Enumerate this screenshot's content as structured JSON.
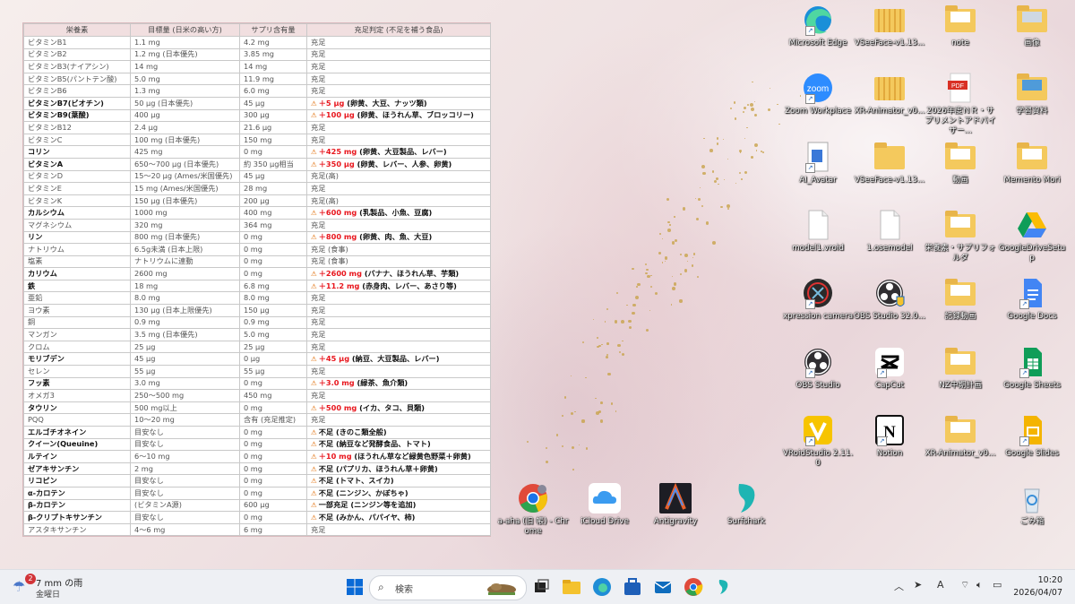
{
  "table": {
    "headers": [
      "栄養素",
      "目標量 (日米の高い方)",
      "サプリ含有量",
      "充足判定 (不足を補う食品)"
    ],
    "rows": [
      {
        "name": "ビタミンB1",
        "target": "1.1 mg",
        "supp": "4.2 mg",
        "status": "充足",
        "shortfall": false
      },
      {
        "name": "ビタミンB2",
        "target": "1.2 mg (日本優先)",
        "supp": "3.85 mg",
        "status": "充足",
        "shortfall": false
      },
      {
        "name": "ビタミンB3(ナイアシン)",
        "target": "14 mg",
        "supp": "14 mg",
        "status": "充足",
        "shortfall": false
      },
      {
        "name": "ビタミンB5(パントテン酸)",
        "target": "5.0 mg",
        "supp": "11.9 mg",
        "status": "充足",
        "shortfall": false
      },
      {
        "name": "ビタミンB6",
        "target": "1.3 mg",
        "supp": "6.0 mg",
        "status": "充足",
        "shortfall": false
      },
      {
        "name": "ビタミンB7(ビオチン)",
        "target": "50 μg (日本優先)",
        "supp": "45 μg",
        "amount": "＋5 μg",
        "status": "(卵黄、大豆、ナッツ類)",
        "shortfall": true
      },
      {
        "name": "ビタミンB9(葉酸)",
        "target": "400 μg",
        "supp": "300 μg",
        "amount": "＋100 μg",
        "status": "(卵黄、ほうれん草、ブロッコリー)",
        "shortfall": true
      },
      {
        "name": "ビタミンB12",
        "target": "2.4 μg",
        "supp": "21.6 μg",
        "status": "充足",
        "shortfall": false
      },
      {
        "name": "ビタミンC",
        "target": "100 mg (日本優先)",
        "supp": "150 mg",
        "status": "充足",
        "shortfall": false
      },
      {
        "name": "コリン",
        "target": "425 mg",
        "supp": "0 mg",
        "amount": "＋425 mg",
        "status": "(卵黄、大豆製品、レバー)",
        "shortfall": true
      },
      {
        "name": "ビタミンA",
        "target": "650〜700 μg (日本優先)",
        "supp": "約 350 μg相当",
        "amount": "＋350 μg",
        "status": "(卵黄、レバー、人参、卵黄)",
        "shortfall": true
      },
      {
        "name": "ビタミンD",
        "target": "15〜20 μg (Ames/米国優先)",
        "supp": "45 μg",
        "status": "充足(高)",
        "shortfall": false
      },
      {
        "name": "ビタミンE",
        "target": "15 mg (Ames/米国優先)",
        "supp": "28 mg",
        "status": "充足",
        "shortfall": false
      },
      {
        "name": "ビタミンK",
        "target": "150 μg (日本優先)",
        "supp": "200 μg",
        "status": "充足(高)",
        "shortfall": false
      },
      {
        "name": "カルシウム",
        "target": "1000 mg",
        "supp": "400 mg",
        "amount": "＋600 mg",
        "status": "(乳製品、小魚、豆腐)",
        "shortfall": true
      },
      {
        "name": "マグネシウム",
        "target": "320 mg",
        "supp": "364 mg",
        "status": "充足",
        "shortfall": false
      },
      {
        "name": "リン",
        "target": "800 mg (日本優先)",
        "supp": "0 mg",
        "amount": "＋800 mg",
        "status": "(卵黄、肉、魚、大豆)",
        "shortfall": true
      },
      {
        "name": "ナトリウム",
        "target": "6.5g未満 (日本上限)",
        "supp": "0 mg",
        "status": "充足 (食事)",
        "shortfall": false
      },
      {
        "name": "塩素",
        "target": "ナトリウムに連動",
        "supp": "0 mg",
        "status": "充足 (食事)",
        "shortfall": false
      },
      {
        "name": "カリウム",
        "target": "2600 mg",
        "supp": "0 mg",
        "amount": "＋2600 mg",
        "status": "(バナナ、ほうれん草、芋類)",
        "shortfall": true
      },
      {
        "name": "鉄",
        "target": "18 mg",
        "supp": "6.8 mg",
        "amount": "＋11.2 mg",
        "status": "(赤身肉、レバー、あさり等)",
        "shortfall": true
      },
      {
        "name": "亜鉛",
        "target": "8.0 mg",
        "supp": "8.0 mg",
        "status": "充足",
        "shortfall": false
      },
      {
        "name": "ヨウ素",
        "target": "130 μg (日本上限優先)",
        "supp": "150 μg",
        "status": "充足",
        "shortfall": false
      },
      {
        "name": "銅",
        "target": "0.9 mg",
        "supp": "0.9 mg",
        "status": "充足",
        "shortfall": false
      },
      {
        "name": "マンガン",
        "target": "3.5 mg (日本優先)",
        "supp": "5.0 mg",
        "status": "充足",
        "shortfall": false
      },
      {
        "name": "クロム",
        "target": "25 μg",
        "supp": "25 μg",
        "status": "充足",
        "shortfall": false
      },
      {
        "name": "モリブデン",
        "target": "45 μg",
        "supp": "0 μg",
        "amount": "＋45 μg",
        "status": "(納豆、大豆製品、レバー)",
        "shortfall": true
      },
      {
        "name": "セレン",
        "target": "55 μg",
        "supp": "55 μg",
        "status": "充足",
        "shortfall": false
      },
      {
        "name": "フッ素",
        "target": "3.0 mg",
        "supp": "0 mg",
        "amount": "＋3.0 mg",
        "status": "(緑茶、魚介類)",
        "shortfall": true
      },
      {
        "name": "オメガ3",
        "target": "250〜500 mg",
        "supp": "450 mg",
        "status": "充足",
        "shortfall": false
      },
      {
        "name": "タウリン",
        "target": "500 mg以上",
        "supp": "0 mg",
        "amount": "＋500 mg",
        "status": "(イカ、タコ、貝類)",
        "shortfall": true
      },
      {
        "name": "PQQ",
        "target": "10〜20 mg",
        "supp": "含有 (充足推定)",
        "status": "充足",
        "shortfall": false
      },
      {
        "name": "エルゴチオネイン",
        "target": "目安なし",
        "supp": "0 mg",
        "status": "不足 (きのこ類全般)",
        "shortfall": true
      },
      {
        "name": "クイーン(Queuine)",
        "target": "目安なし",
        "supp": "0 mg",
        "status": "不足 (納豆など発酵食品、トマト)",
        "shortfall": true
      },
      {
        "name": "ルテイン",
        "target": "6〜10 mg",
        "supp": "0 mg",
        "amount": "＋10 mg",
        "status": "(ほうれん草など緑黄色野菜＋卵黄)",
        "shortfall": true
      },
      {
        "name": "ゼアキサンチン",
        "target": "2 mg",
        "supp": "0 mg",
        "status": "不足 (パプリカ、ほうれん草＋卵黄)",
        "shortfall": true
      },
      {
        "name": "リコピン",
        "target": "目安なし",
        "supp": "0 mg",
        "status": "不足 (トマト、スイカ)",
        "shortfall": true
      },
      {
        "name": "α-カロテン",
        "target": "目安なし",
        "supp": "0 mg",
        "status": "不足 (ニンジン、かぼちゃ)",
        "shortfall": true
      },
      {
        "name": "β-カロテン",
        "target": "(ビタミンA源)",
        "supp": "600 μg",
        "status": "一部充足 (ニンジン等を追加)",
        "shortfall": "partial"
      },
      {
        "name": "β-クリプトキサンチン",
        "target": "目安なし",
        "supp": "0 mg",
        "status": "不足 (みかん、パパイヤ、柿)",
        "shortfall": true
      },
      {
        "name": "アスタキサンチン",
        "target": "4〜6 mg",
        "supp": "6 mg",
        "status": "充足",
        "shortfall": false
      }
    ]
  },
  "desktop_icons": [
    {
      "label": "Microsoft Edge",
      "kind": "edge",
      "col": 0,
      "row": 0,
      "shortcut": true
    },
    {
      "label": "VSeeFace-v1.13...",
      "kind": "zip",
      "col": 1,
      "row": 0,
      "shortcut": false
    },
    {
      "label": "note",
      "kind": "folder",
      "col": 2,
      "row": 0,
      "shortcut": false
    },
    {
      "label": "画像",
      "kind": "folder-img",
      "col": 3,
      "row": 0,
      "shortcut": false
    },
    {
      "label": "Zoom Workplace",
      "kind": "zoom",
      "col": 0,
      "row": 1,
      "shortcut": true
    },
    {
      "label": "XR-Animator_v0...",
      "kind": "zip",
      "col": 1,
      "row": 1,
      "shortcut": false
    },
    {
      "label": "2026年度ＮＲ・サプリメントアドバイザー...",
      "kind": "pdf",
      "col": 2,
      "row": 1,
      "shortcut": false
    },
    {
      "label": "学習資料",
      "kind": "folder-blue",
      "col": 3,
      "row": 1,
      "shortcut": false
    },
    {
      "label": "AI_Avatar",
      "kind": "file-blue",
      "col": 0,
      "row": 2,
      "shortcut": true
    },
    {
      "label": "VSeeFace-v1.13...",
      "kind": "folder-plain",
      "col": 1,
      "row": 2,
      "shortcut": false
    },
    {
      "label": "動画",
      "kind": "folder",
      "col": 2,
      "row": 2,
      "shortcut": false
    },
    {
      "label": "Memento Mori",
      "kind": "folder",
      "col": 3,
      "row": 2,
      "shortcut": false
    },
    {
      "label": "model1.vroid",
      "kind": "doc",
      "col": 0,
      "row": 3,
      "shortcut": false
    },
    {
      "label": "1.osemodel",
      "kind": "doc",
      "col": 1,
      "row": 3,
      "shortcut": false
    },
    {
      "label": "栄養素・サプリフォルダ",
      "kind": "folder",
      "col": 2,
      "row": 3,
      "shortcut": false
    },
    {
      "label": "GoogleDriveSetup",
      "kind": "gdrive",
      "col": 3,
      "row": 3,
      "shortcut": false
    },
    {
      "label": "xpression camera",
      "kind": "xpression",
      "col": 0,
      "row": 4,
      "shortcut": true
    },
    {
      "label": "OBS Studio 32.0...",
      "kind": "obs-shield",
      "col": 1,
      "row": 4,
      "shortcut": false
    },
    {
      "label": "記録動画",
      "kind": "folder",
      "col": 2,
      "row": 4,
      "shortcut": false
    },
    {
      "label": "Google Docs",
      "kind": "gdocs",
      "col": 3,
      "row": 4,
      "shortcut": true
    },
    {
      "label": "OBS Studio",
      "kind": "obs",
      "col": 0,
      "row": 5,
      "shortcut": true
    },
    {
      "label": "CapCut",
      "kind": "capcut",
      "col": 1,
      "row": 5,
      "shortcut": true
    },
    {
      "label": "NZ中期計画",
      "kind": "folder",
      "col": 2,
      "row": 5,
      "shortcut": false
    },
    {
      "label": "Google Sheets",
      "kind": "gsheets",
      "col": 3,
      "row": 5,
      "shortcut": true
    },
    {
      "label": "VRoidStudio 2.11.0",
      "kind": "vroid",
      "col": 0,
      "row": 6,
      "shortcut": true
    },
    {
      "label": "Notion",
      "kind": "notion",
      "col": 1,
      "row": 6,
      "shortcut": true
    },
    {
      "label": "XR-Animator_v0...",
      "kind": "folder",
      "col": 2,
      "row": 6,
      "shortcut": false
    },
    {
      "label": "Google Slides",
      "kind": "gslides",
      "col": 3,
      "row": 6,
      "shortcut": true
    },
    {
      "label": "ごみ箱",
      "kind": "recycle",
      "col": 3,
      "row": 7,
      "shortcut": false
    }
  ],
  "lower_icons": [
    {
      "label": "a-aha (旧 帳) - Chrome",
      "kind": "chrome"
    },
    {
      "label": "iCloud Drive",
      "kind": "icloud"
    },
    {
      "label": "Antigravity",
      "kind": "antigravity"
    },
    {
      "label": "Surfshark",
      "kind": "surfshark"
    }
  ],
  "taskbar": {
    "weather_badge": "2",
    "weather_line1": "7 mm の雨",
    "weather_line2": "金曜日",
    "search_placeholder": "検索",
    "time": "10:20",
    "date": "2026/04/07",
    "ime": "A"
  }
}
